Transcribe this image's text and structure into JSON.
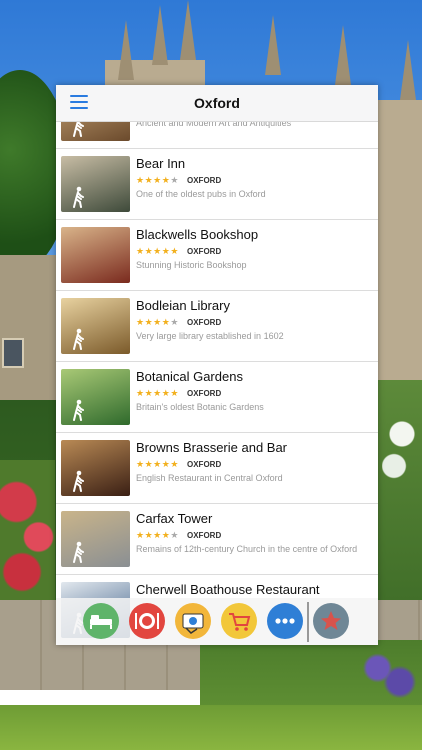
{
  "header": {
    "title": "Oxford"
  },
  "places": [
    {
      "name": "",
      "desc": "Ancient and Modern Art and Antiquities",
      "rating": 0,
      "city": "",
      "walking": true
    },
    {
      "name": "Bear Inn",
      "desc": "One of the oldest pubs in Oxford",
      "rating": 4,
      "city": "OXFORD",
      "walking": true
    },
    {
      "name": "Blackwells Bookshop",
      "desc": "Stunning Historic Bookshop",
      "rating": 5,
      "city": "OXFORD",
      "walking": false
    },
    {
      "name": "Bodleian Library",
      "desc": "Very large library established in 1602",
      "rating": 4,
      "city": "OXFORD",
      "walking": true
    },
    {
      "name": "Botanical Gardens",
      "desc": "Britain's oldest Botanic Gardens",
      "rating": 5,
      "city": "OXFORD",
      "walking": true
    },
    {
      "name": "Browns Brasserie and Bar",
      "desc": "English Restaurant in Central Oxford",
      "rating": 5,
      "city": "OXFORD",
      "walking": true
    },
    {
      "name": "Carfax Tower",
      "desc": "Remains of 12th-century Church in the centre of Oxford",
      "rating": 4,
      "city": "OXFORD",
      "walking": true
    },
    {
      "name": "Cherwell Boathouse Restaurant",
      "desc": "",
      "rating": 0,
      "city": "",
      "walking": true
    }
  ],
  "toolbar": {
    "buttons": [
      {
        "icon": "bed-icon",
        "color": "#5fb46a"
      },
      {
        "icon": "restaurant-icon",
        "color": "#e2463f"
      },
      {
        "icon": "sightseeing-icon",
        "color": "#f2b63a"
      },
      {
        "icon": "shopping-cart-icon",
        "color": "#f2c73a"
      },
      {
        "icon": "more-icon",
        "color": "#2f7fd6"
      },
      {
        "icon": "favorites-star-icon",
        "color": "#6f8796"
      }
    ]
  }
}
